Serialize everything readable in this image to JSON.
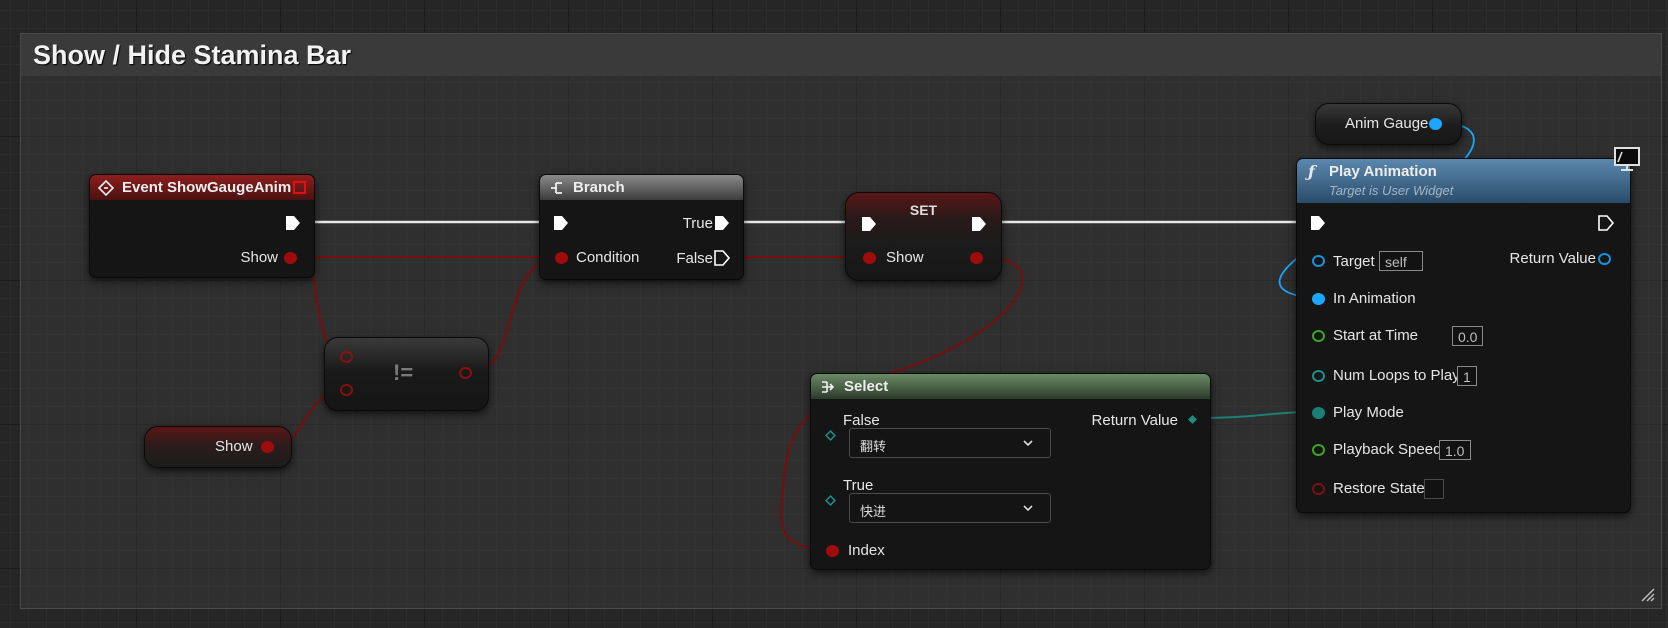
{
  "comment": {
    "title": "Show / Hide Stamina Bar"
  },
  "event_node": {
    "title": "Event ShowGaugeAnim",
    "output_pin": "Show"
  },
  "branch_node": {
    "title": "Branch",
    "condition_pin": "Condition",
    "true_pin": "True",
    "false_pin": "False"
  },
  "set_node": {
    "title": "SET",
    "pin": "Show"
  },
  "not_equal_node": {
    "symbol": "!="
  },
  "show_getter": {
    "label": "Show"
  },
  "anim_gauge": {
    "label": "Anim Gauge"
  },
  "select_node": {
    "title": "Select",
    "false_label": "False",
    "false_value": "翻转",
    "true_label": "True",
    "true_value": "快进",
    "index_label": "Index",
    "return_label": "Return Value"
  },
  "play_node": {
    "title": "Play Animation",
    "subtitle": "Target is User Widget",
    "target_label": "Target",
    "target_value": "self",
    "return_label": "Return Value",
    "in_animation_label": "In Animation",
    "start_label": "Start at Time",
    "start_value": "0.0",
    "loops_label": "Num Loops to Play",
    "loops_value": "1",
    "mode_label": "Play Mode",
    "speed_label": "Playback Speed",
    "speed_value": "1.0",
    "restore_label": "Restore State"
  },
  "colors": {
    "exec": "#ffffff",
    "boolean": "#a00c0c",
    "object": "#1aa7ff",
    "float": "#3aa626",
    "enum": "#1c7f76",
    "event_header": "#7a1a1a",
    "select_header": "#4e6b4a",
    "function_header": "#3d6a8c"
  }
}
